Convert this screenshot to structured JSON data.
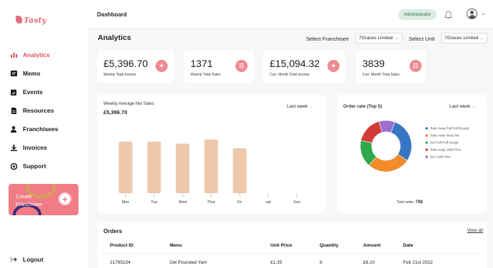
{
  "app": {
    "logo_text": "Tasty"
  },
  "sidebar": {
    "items": [
      {
        "label": "Analytics",
        "icon": "bar-chart-icon"
      },
      {
        "label": "Memo",
        "icon": "memo-icon"
      },
      {
        "label": "Events",
        "icon": "calendar-icon"
      },
      {
        "label": "Resources",
        "icon": "document-icon"
      },
      {
        "label": "Franchisees",
        "icon": "user-icon"
      },
      {
        "label": "Invoices",
        "icon": "invoice-icon"
      },
      {
        "label": "Support",
        "icon": "support-icon"
      }
    ],
    "create_label": "Create Franchisee",
    "logout_label": "Logout"
  },
  "header": {
    "title": "Dashboard",
    "role": "Administrator"
  },
  "analytics": {
    "title": "Analytics",
    "franchise_label": "Select Franchisee",
    "franchise_value": "7Graces Limited",
    "unit_label": "Select Unit",
    "unit_value": "7Graces Limited"
  },
  "stats": [
    {
      "value": "£5,396.70",
      "label": "Weekly Total Income"
    },
    {
      "value": "1371",
      "label": "Weekly Total Sales"
    },
    {
      "value": "£15,094.32",
      "label": "Curr. Month Total Income"
    },
    {
      "value": "3839",
      "label": "Curr. Month Total Sales"
    }
  ],
  "sales_panel": {
    "title": "Weekly Average Net Sales",
    "value": "£5,396.70",
    "range": "Last week"
  },
  "order_panel": {
    "title": "Order rate (Top 5)",
    "range": "Last week",
    "total_label": "Total order:",
    "total_value": "798"
  },
  "chart_data": [
    {
      "type": "bar",
      "categories": [
        "Mon",
        "Tue",
        "Wed",
        "Thur",
        "Fri",
        "sat",
        "Sun"
      ],
      "values": [
        0.77,
        0.77,
        0.74,
        0.8,
        0.67,
        0,
        0
      ],
      "title": "Weekly Average Net Sales",
      "color": "#eec8aa"
    },
    {
      "type": "pie",
      "title": "Order rate (Top 5)",
      "labels": [
        "Take Away Puff Puff Dough",
        "Take Away Meat Pie",
        "Del Puff Puff Dough",
        "Take Away Jollof Rice",
        "Del Jollof Rice"
      ],
      "values": [
        29,
        27,
        17,
        17,
        10
      ],
      "colors": [
        "#3876c3",
        "#f28b2c",
        "#30a94a",
        "#d33b3b",
        "#9c6ed1"
      ]
    }
  ],
  "orders": {
    "title": "Orders",
    "view_all": "View all",
    "columns": [
      "Product ID",
      "Menu",
      "Unit Price",
      "Quantity",
      "Amount",
      "Date"
    ],
    "rows": [
      [
        "21785224",
        "Del Pounded Yam",
        "£1.35",
        "6",
        "£8.10",
        "Feb 21st 2022"
      ]
    ]
  },
  "colors": {
    "accent": "#e0505e",
    "badge_bg": "#dbeee1",
    "bar": "#eec8aa",
    "stat_btn": "#ef8a93"
  }
}
